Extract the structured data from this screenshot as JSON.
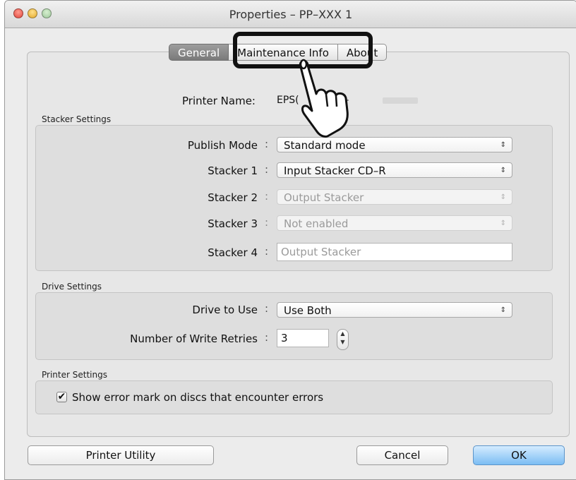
{
  "window": {
    "title": "Properties – PP–XXX 1"
  },
  "tabs": [
    {
      "label": "General",
      "active": true
    },
    {
      "label": "Maintenance Info",
      "active": false
    },
    {
      "label": "About",
      "active": false
    }
  ],
  "printer": {
    "name_label": "Printer Name:",
    "name_value": "EPS(          XX–"
  },
  "stacker_settings": {
    "section_label": "Stacker Settings",
    "publish_mode": {
      "label": "Publish Mode",
      "value": "Standard mode"
    },
    "stacker1": {
      "label": "Stacker 1",
      "value": "Input Stacker CD–R"
    },
    "stacker2": {
      "label": "Stacker 2",
      "value": "Output Stacker"
    },
    "stacker3": {
      "label": "Stacker 3",
      "value": "Not enabled"
    },
    "stacker4": {
      "label": "Stacker 4",
      "value": "Output Stacker"
    }
  },
  "drive_settings": {
    "section_label": "Drive Settings",
    "drive_to_use": {
      "label": "Drive to Use",
      "value": "Use Both"
    },
    "write_retries": {
      "label": "Number of Write Retries",
      "value": "3"
    }
  },
  "printer_settings": {
    "section_label": "Printer Settings",
    "show_error_mark": {
      "label": "Show error mark on discs that encounter errors",
      "checked": true
    }
  },
  "colon": ":",
  "buttons": {
    "printer_utility": "Printer Utility",
    "cancel": "Cancel",
    "ok": "OK"
  },
  "icons": {
    "popup_arrows": "updown-arrows-icon",
    "checkmark": "checkmark-icon",
    "pointer": "pointing-hand-icon"
  }
}
